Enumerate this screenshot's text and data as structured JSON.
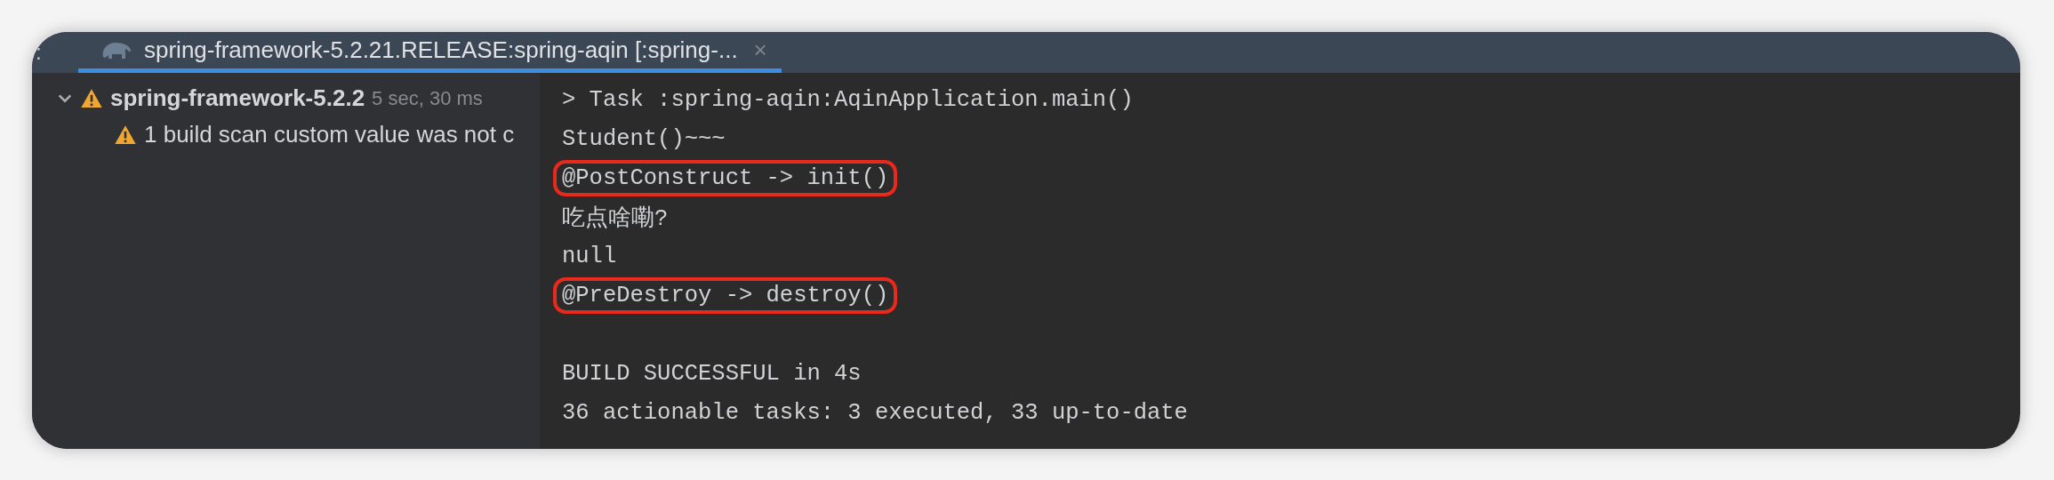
{
  "tool_window": {
    "label": ":"
  },
  "tab": {
    "title": "spring-framework-5.2.21.RELEASE:spring-aqin [:spring-...",
    "close": "×",
    "selected": true
  },
  "tree": [
    {
      "kind": "warning",
      "title": "spring-framework-5.2.2",
      "time": "5 sec, 30 ms",
      "expanded": true,
      "children": [
        {
          "kind": "warning",
          "title": "1 build scan custom value was not c"
        }
      ]
    }
  ],
  "console": [
    {
      "kind": "text",
      "text": "> Task :spring-aqin:AqinApplication.main()",
      "highlighted": false
    },
    {
      "kind": "text",
      "text": "Student()~~~",
      "highlighted": false
    },
    {
      "kind": "text",
      "text": "@PostConstruct -> init()",
      "highlighted": true
    },
    {
      "kind": "text",
      "text": "吃点啥嘞?",
      "highlighted": false
    },
    {
      "kind": "text",
      "text": "null",
      "highlighted": false
    },
    {
      "kind": "text",
      "text": "@PreDestroy -> destroy()",
      "highlighted": true
    },
    {
      "kind": "blank"
    },
    {
      "kind": "text",
      "text": "BUILD SUCCESSFUL in 4s",
      "highlighted": false
    },
    {
      "kind": "text",
      "text": "36 actionable tasks: 3 executed, 33 up-to-date",
      "highlighted": false
    }
  ]
}
